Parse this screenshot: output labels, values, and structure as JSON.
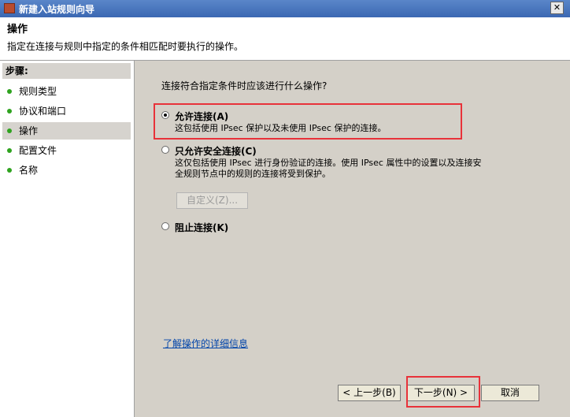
{
  "window": {
    "title": "新建入站规则向导",
    "close_glyph": "✕"
  },
  "header": {
    "title": "操作",
    "subtitle": "指定在连接与规则中指定的条件相匹配时要执行的操作。"
  },
  "sidebar": {
    "title": "步骤:",
    "items": [
      {
        "label": "规则类型",
        "active": false
      },
      {
        "label": "协议和端口",
        "active": false
      },
      {
        "label": "操作",
        "active": true
      },
      {
        "label": "配置文件",
        "active": false
      },
      {
        "label": "名称",
        "active": false
      }
    ]
  },
  "main": {
    "question": "连接符合指定条件时应该进行什么操作?",
    "options": [
      {
        "label": "允许连接(A)",
        "description": [
          "这包括使用 IPsec 保护以及未使用 IPsec 保护的连接。"
        ],
        "selected": true
      },
      {
        "label": "只允许安全连接(C)",
        "description": [
          "这仅包括使用 IPsec 进行身份验证的连接。使用 IPsec 属性中的设置以及连接安",
          "全规则节点中的规则的连接将受到保护。"
        ],
        "selected": false
      },
      {
        "label": "阻止连接(K)",
        "description": [],
        "selected": false
      }
    ],
    "customize_button": "自定义(Z)...",
    "learn_more_link": "了解操作的详细信息"
  },
  "footer": {
    "back_button": "< 上一步(B)",
    "next_button": "下一步(N) >",
    "cancel_button": "取消"
  },
  "colors": {
    "highlight_box": "#e8323a",
    "titlebar": "#3b68b3",
    "step_dot": "#2fa31f"
  }
}
